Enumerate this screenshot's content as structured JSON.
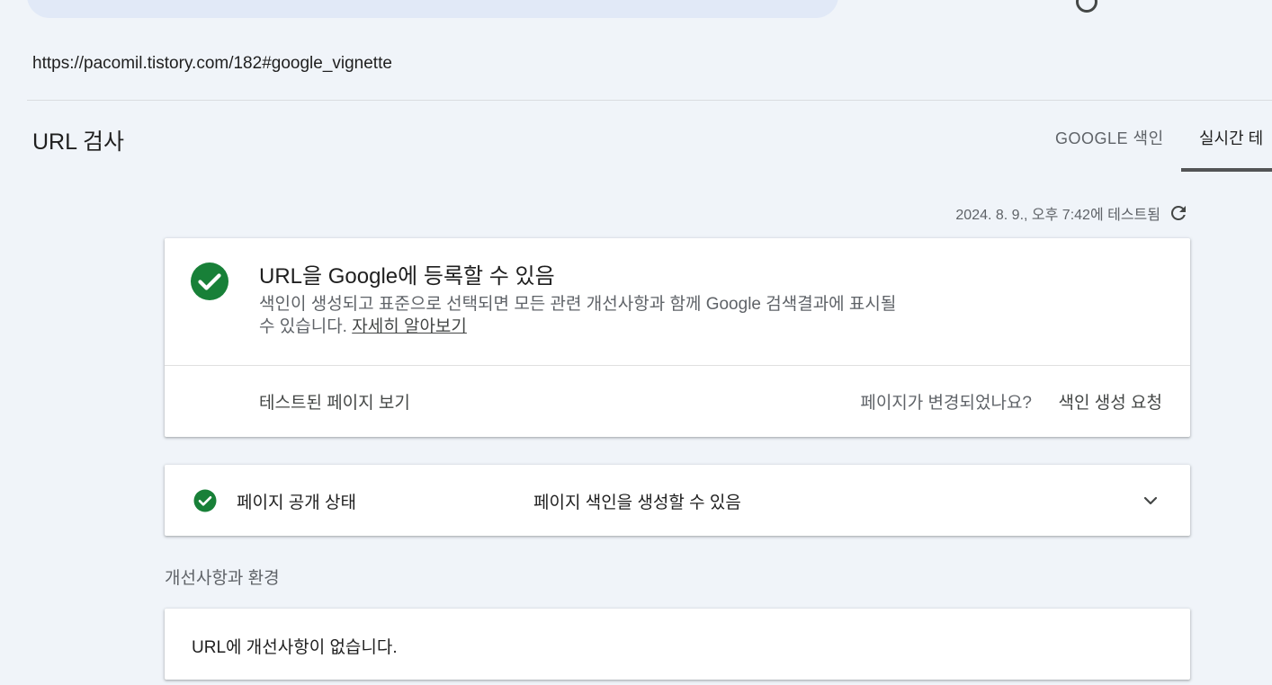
{
  "header": {
    "inspected_url": "https://pacomil.tistory.com/182#google_vignette"
  },
  "page": {
    "title": "URL 검사",
    "tabs": [
      {
        "label": "GOOGLE 색인",
        "selected": false
      },
      {
        "label": "실시간 테",
        "selected": true
      }
    ],
    "tested_at": "2024. 8. 9., 오후 7:42에 테스트됨"
  },
  "status_card": {
    "title": "URL을 Google에 등록할 수 있음",
    "description": "색인이 생성되고 표준으로 선택되면 모든 관련 개선사항과 함께 Google 검색결과에 표시될 수 있습니다.",
    "learn_more": "자세히 알아보기",
    "view_tested_page": "테스트된 페이지 보기",
    "page_changed_prompt": "페이지가 변경되었나요?",
    "request_indexing": "색인 생성 요청",
    "status_color": "#188038"
  },
  "availability": {
    "label": "페이지 공개 상태",
    "value": "페이지 색인을 생성할 수 있음"
  },
  "enhancements": {
    "section_title": "개선사항과 환경",
    "message": "URL에 개선사항이 없습니다."
  },
  "icons": {
    "status": "check-circle-icon",
    "refresh": "refresh-icon",
    "expand": "chevron-down-icon"
  }
}
